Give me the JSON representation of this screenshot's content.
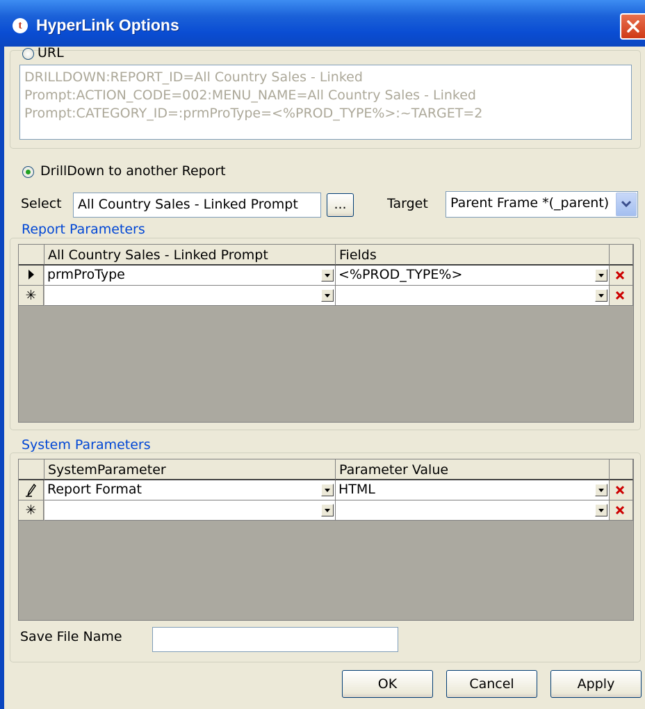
{
  "window": {
    "title": "HyperLink Options"
  },
  "url_section": {
    "radio_label": "URL",
    "lines": [
      "DRILLDOWN:REPORT_ID=All Country Sales - Linked",
      "Prompt:ACTION_CODE=002:MENU_NAME=All Country Sales - Linked",
      "Prompt:CATEGORY_ID=:prmProType=<%PROD_TYPE%>:~TARGET=2"
    ]
  },
  "drilldown": {
    "radio_label": "DrillDown to another Report",
    "select_label": "Select",
    "select_value": "All Country Sales - Linked Prompt",
    "browse_label": "...",
    "target_label": "Target",
    "target_value": "Parent Frame *(_parent)"
  },
  "report_parameters": {
    "legend": "Report Parameters",
    "columns": [
      "All Country Sales - Linked Prompt",
      "Fields"
    ],
    "rows": [
      {
        "marker": "current",
        "param": "prmProType",
        "field": "<%PROD_TYPE%>"
      },
      {
        "marker": "new",
        "param": "",
        "field": ""
      }
    ]
  },
  "system_parameters": {
    "legend": "System Parameters",
    "columns": [
      "SystemParameter",
      "Parameter Value"
    ],
    "rows": [
      {
        "marker": "editing",
        "param": "Report Format",
        "value": "HTML"
      },
      {
        "marker": "new",
        "param": "",
        "value": ""
      }
    ]
  },
  "save_file": {
    "label": "Save File Name",
    "value": ""
  },
  "buttons": {
    "ok": "OK",
    "cancel": "Cancel",
    "apply": "Apply"
  },
  "colors": {
    "titlebar": "#0b46c0",
    "accent": "#0046d5",
    "dialog_bg": "#ece9d8",
    "delete_x": "#cc0000"
  }
}
